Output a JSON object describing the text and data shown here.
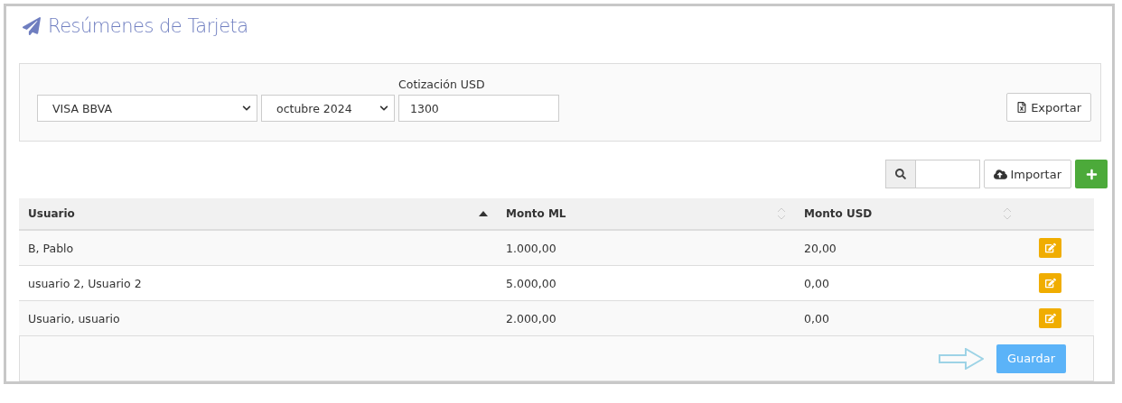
{
  "title": "Resúmenes de Tarjeta",
  "filters": {
    "card": {
      "value": "VISA BBVA"
    },
    "period": {
      "value": "octubre 2024"
    },
    "rate": {
      "label": "Cotización USD",
      "value": "1300"
    },
    "export_button": "Exportar"
  },
  "toolbar": {
    "import_button": "Importar"
  },
  "table": {
    "columns": [
      {
        "label": "Usuario",
        "sorted": true
      },
      {
        "label": "Monto ML",
        "sorted": false
      },
      {
        "label": "Monto USD",
        "sorted": false
      }
    ],
    "rows": [
      {
        "cells": [
          "B, Pablo",
          "1.000,00",
          "20,00"
        ]
      },
      {
        "cells": [
          "usuario 2, Usuario 2",
          "5.000,00",
          "0,00"
        ]
      },
      {
        "cells": [
          "Usuario, usuario",
          "2.000,00",
          "0,00"
        ]
      }
    ]
  },
  "footer": {
    "save_button": "Guardar"
  }
}
